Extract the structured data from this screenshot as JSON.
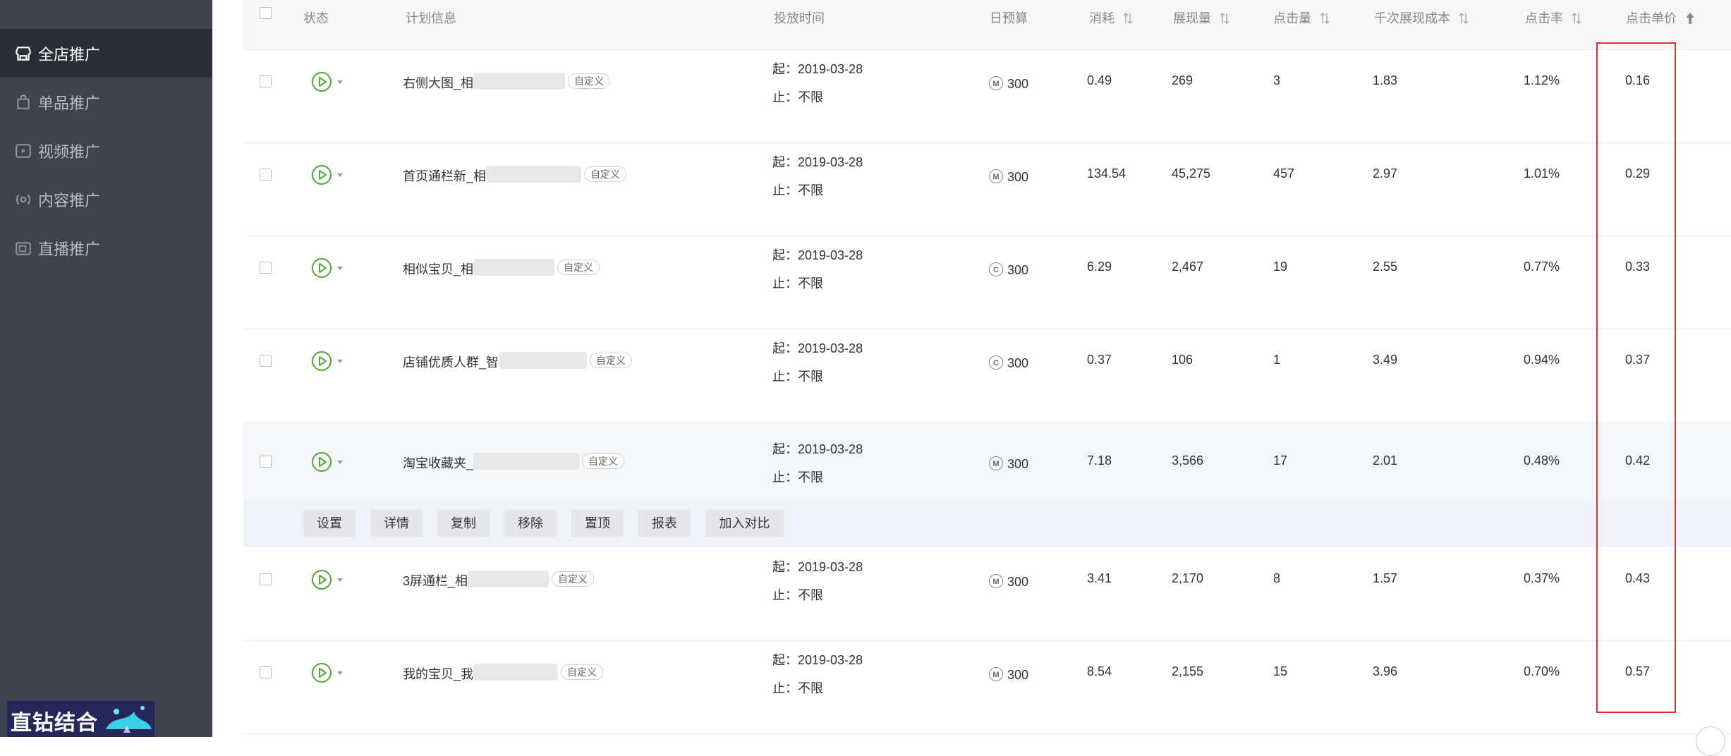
{
  "sidebar": {
    "items": [
      {
        "label": "全店推广",
        "icon": "store-icon",
        "active": true
      },
      {
        "label": "单品推广",
        "icon": "bag-icon",
        "active": false
      },
      {
        "label": "视频推广",
        "icon": "video-icon",
        "active": false
      },
      {
        "label": "内容推广",
        "icon": "content-icon",
        "active": false
      },
      {
        "label": "直播推广",
        "icon": "live-icon",
        "active": false
      }
    ],
    "promo_text": "直钻结合"
  },
  "table": {
    "headers": {
      "status": "状态",
      "plan": "计划信息",
      "time": "投放时间",
      "budget": "日预算",
      "cost": "消耗",
      "impressions": "展现量",
      "clicks": "点击量",
      "cpm": "千次展现成本",
      "ctr": "点击率",
      "cpc": "点击单价"
    },
    "rows": [
      {
        "name": "右侧大图_相",
        "tag": "自定义",
        "start": "起：2019-03-28",
        "end": "止：不限",
        "budget_type": "M",
        "budget": "300",
        "cost": "0.49",
        "impressions": "269",
        "clicks": "3",
        "cpm": "1.83",
        "ctr": "1.12%",
        "cpc": "0.16"
      },
      {
        "name": "首页通栏新_相",
        "tag": "自定义",
        "start": "起：2019-03-28",
        "end": "止：不限",
        "budget_type": "M",
        "budget": "300",
        "cost": "134.54",
        "impressions": "45,275",
        "clicks": "457",
        "cpm": "2.97",
        "ctr": "1.01%",
        "cpc": "0.29"
      },
      {
        "name": "相似宝贝_相",
        "tag": "自定义",
        "start": "起：2019-03-28",
        "end": "止：不限",
        "budget_type": "C",
        "budget": "300",
        "cost": "6.29",
        "impressions": "2,467",
        "clicks": "19",
        "cpm": "2.55",
        "ctr": "0.77%",
        "cpc": "0.33"
      },
      {
        "name": "店铺优质人群_智",
        "tag": "自定义",
        "start": "起：2019-03-28",
        "end": "止：不限",
        "budget_type": "C",
        "budget": "300",
        "cost": "0.37",
        "impressions": "106",
        "clicks": "1",
        "cpm": "3.49",
        "ctr": "0.94%",
        "cpc": "0.37"
      },
      {
        "name": "淘宝收藏夹_",
        "tag": "自定义",
        "start": "起：2019-03-28",
        "end": "止：不限",
        "budget_type": "M",
        "budget": "300",
        "cost": "7.18",
        "impressions": "3,566",
        "clicks": "17",
        "cpm": "2.01",
        "ctr": "0.48%",
        "cpc": "0.42"
      },
      {
        "name": "3屏通栏_相",
        "tag": "自定义",
        "start": "起：2019-03-28",
        "end": "止：不限",
        "budget_type": "M",
        "budget": "300",
        "cost": "3.41",
        "impressions": "2,170",
        "clicks": "8",
        "cpm": "1.57",
        "ctr": "0.37%",
        "cpc": "0.43"
      },
      {
        "name": "我的宝贝_我",
        "tag": "自定义",
        "start": "起：2019-03-28",
        "end": "止：不限",
        "budget_type": "M",
        "budget": "300",
        "cost": "8.54",
        "impressions": "2,155",
        "clicks": "15",
        "cpm": "3.96",
        "ctr": "0.70%",
        "cpc": "0.57"
      }
    ],
    "actions": [
      "设置",
      "详情",
      "复制",
      "移除",
      "置顶",
      "报表",
      "加入对比"
    ]
  },
  "colors": {
    "sidebar_bg": "#3f4350",
    "sidebar_active": "#2b2e37",
    "status_green": "#52a532",
    "highlight_red": "#e0312d"
  }
}
